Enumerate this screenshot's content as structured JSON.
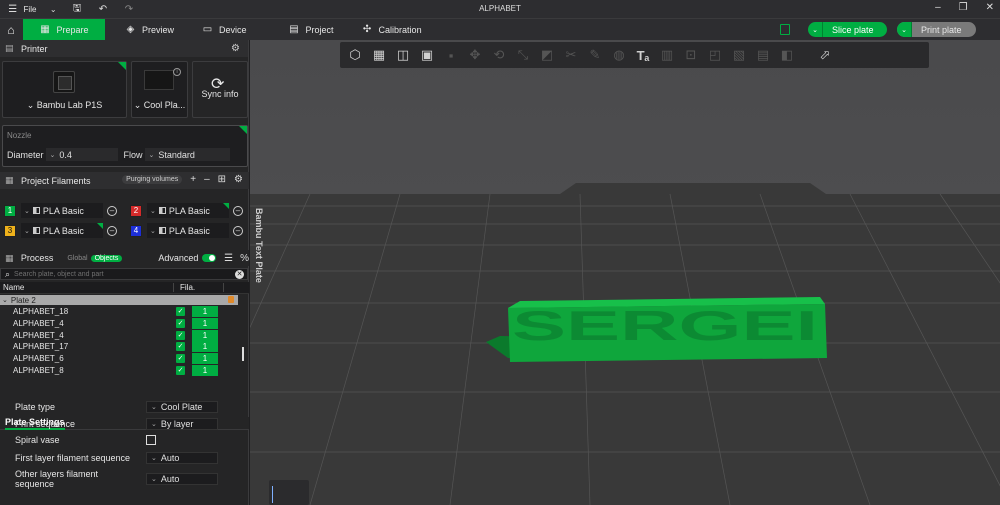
{
  "window": {
    "title": "ALPHABET",
    "file_menu": "File"
  },
  "tabs": {
    "prepare": "Prepare",
    "preview": "Preview",
    "device": "Device",
    "project": "Project",
    "calibration": "Calibration"
  },
  "actions": {
    "slice": "Slice plate",
    "print": "Print plate"
  },
  "printer": {
    "section_title": "Printer",
    "model": "Bambu Lab P1S",
    "plate": "Cool Pla...",
    "sync": "Sync info"
  },
  "nozzle": {
    "title": "Nozzle",
    "diameter_label": "Diameter",
    "diameter_value": "0.4",
    "flow_label": "Flow",
    "flow_value": "Standard"
  },
  "filaments": {
    "section_title": "Project Filaments",
    "purging": "Purging volumes",
    "items": [
      {
        "num": "1",
        "name": "PLA Basic",
        "color": "#00ae42"
      },
      {
        "num": "2",
        "name": "PLA Basic",
        "color": "#d42a2a"
      },
      {
        "num": "3",
        "name": "PLA Basic",
        "color": "#f0b21b"
      },
      {
        "num": "4",
        "name": "PLA Basic",
        "color": "#1d2fd8"
      }
    ]
  },
  "process": {
    "section_title": "Process",
    "global": "Global",
    "objects": "Objects",
    "advanced": "Advanced",
    "search_placeholder": "Search plate, object and part"
  },
  "objects_table": {
    "col_name": "Name",
    "col_fila": "Fila.",
    "plate": "Plate 2",
    "rows": [
      {
        "name": "ALPHABET_18",
        "fila": "1"
      },
      {
        "name": "ALPHABET_4",
        "fila": "1"
      },
      {
        "name": "ALPHABET_4",
        "fila": "1"
      },
      {
        "name": "ALPHABET_17",
        "fila": "1"
      },
      {
        "name": "ALPHABET_6",
        "fila": "1"
      },
      {
        "name": "ALPHABET_8",
        "fila": "1"
      }
    ]
  },
  "plate_settings": {
    "tab": "Plate Settings",
    "plate_type_label": "Plate type",
    "plate_type_value": "Cool Plate",
    "print_seq_label": "Print sequence",
    "print_seq_value": "By layer",
    "spiral_label": "Spiral vase",
    "first_layer_label": "First layer filament sequence",
    "first_layer_value": "Auto",
    "other_layers_label": "Other layers filament sequence",
    "other_layers_value": "Auto"
  },
  "viewport": {
    "model_text": "SERGEI",
    "model_color": "#0fa63c",
    "plate_label": "Bambu Text Plate"
  }
}
